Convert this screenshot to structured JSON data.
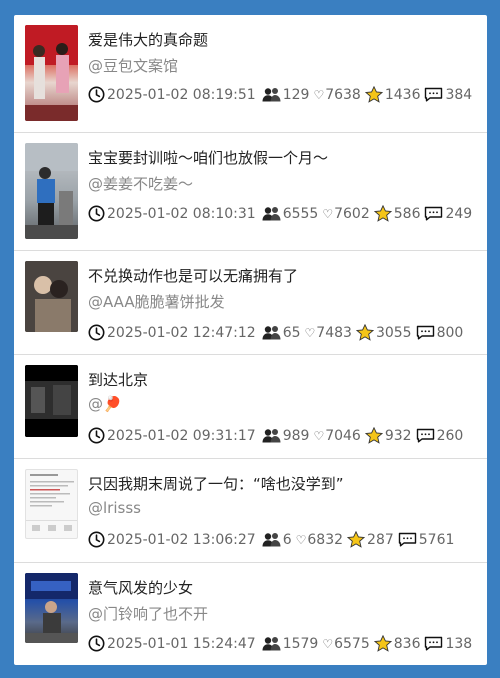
{
  "colors": {
    "background": "#3a7fc1",
    "card": "#ffffff",
    "star": "#f5c518",
    "text_secondary": "#888888"
  },
  "icons": {
    "time": "clock-icon",
    "users": "users-icon",
    "likes": "heart-icon",
    "favorites": "star-icon",
    "comments": "comment-icon"
  },
  "posts": [
    {
      "title": "爱是伟大的真命题",
      "author": "@豆包文案馆",
      "time": "2025-01-02 08:19:51",
      "users": "129",
      "likes": "7638",
      "stars": "1436",
      "comments": "384"
    },
    {
      "title": "宝宝要封训啦～咱们也放假一个月～",
      "author": "@姜姜不吃姜～",
      "time": "2025-01-02 08:10:31",
      "users": "6555",
      "likes": "7602",
      "stars": "586",
      "comments": "249"
    },
    {
      "title": "不兑换动作也是可以无痛拥有了",
      "author": "@AAA脆脆薯饼批发",
      "time": "2025-01-02 12:47:12",
      "users": "65",
      "likes": "7483",
      "stars": "3055",
      "comments": "800"
    },
    {
      "title": "到达北京",
      "author": "@🏓",
      "time": "2025-01-02 09:31:17",
      "users": "989",
      "likes": "7046",
      "stars": "932",
      "comments": "260"
    },
    {
      "title": "只因我期末周说了一句：“啥也没学到”",
      "author": "@lrisss",
      "time": "2025-01-02 13:06:27",
      "users": "6",
      "likes": "6832",
      "stars": "287",
      "comments": "5761"
    },
    {
      "title": "意气风发的少女",
      "author": "@门铃响了也不开",
      "time": "2025-01-01 15:24:47",
      "users": "1579",
      "likes": "6575",
      "stars": "836",
      "comments": "138"
    }
  ]
}
